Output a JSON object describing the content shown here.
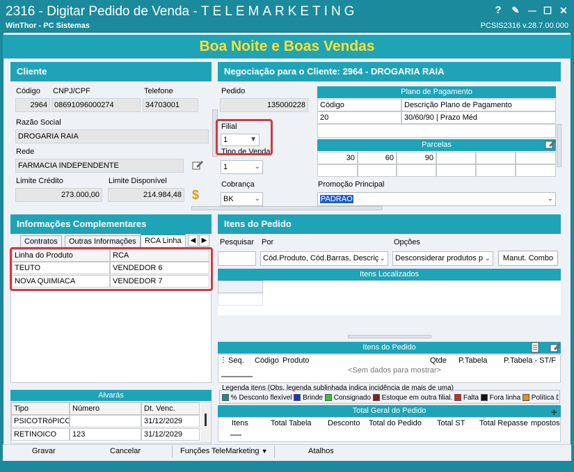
{
  "window": {
    "title_prefix": "2316 - Digitar Pedido de Venda - ",
    "title_suffix": "TELEMARKETING",
    "subtitle": "WinThor - PC Sistemas",
    "version": "PCSIS2316  v.28.7.00.000",
    "btn_help": "?",
    "btn_edit": "✎",
    "btn_min": "—",
    "btn_max": "☐",
    "btn_close": "✕"
  },
  "banner": "Boa Noite e Boas Vendas",
  "cliente": {
    "header": "Cliente",
    "codigo_label": "Código",
    "codigo": "2964",
    "cnpj_label": "CNPJ/CPF",
    "cnpj": "08691096000274",
    "telefone_label": "Telefone",
    "telefone": "34703001",
    "razao_label": "Razão Social",
    "razao": "DROGARIA RAIA",
    "rede_label": "Rede",
    "rede": "FARMACIA INDEPENDENTE",
    "limite_label": "Limite Crédito",
    "limite": "273.000,00",
    "disp_label": "Limite Disponível",
    "disp": "214.984,48",
    "dollar": "$"
  },
  "negociacao": {
    "header": "Negociação para o Cliente: 2964 - DROGARIA RAIA",
    "pedido_label": "Pedido",
    "pedido": "135000228",
    "filial_label": "Filial",
    "filial": "1",
    "tipo_label": "Tipo de Venda",
    "tipo": "1",
    "cobranca_label": "Cobrança",
    "cobranca": "BK",
    "plano_header": "Plano de Pagamento",
    "plano_col1": "Código",
    "plano_col2": "Descrição Plano de Pagamento",
    "plano_codigo": "20",
    "plano_desc": "30/60/90 | Prazo Méd",
    "parcelas_header": "Parcelas",
    "parcelas": [
      "30",
      "60",
      "90",
      "",
      "",
      "",
      ""
    ],
    "promo_label": "Promoção Principal",
    "promo": "PADRAO"
  },
  "info": {
    "header": "Informações Complementares",
    "tabs": [
      "Contratos",
      "Outras Informações",
      "RCA Linha"
    ],
    "col1": "Linha do Produto",
    "col2": "RCA",
    "rows": [
      {
        "linha": "TEUTO",
        "rca": "VENDEDOR 6"
      },
      {
        "linha": "NOVA QUIMIACA",
        "rca": "VENDEDOR 7"
      }
    ]
  },
  "alvaras": {
    "header": "Alvarás",
    "col1": "Tipo",
    "col2": "Número",
    "col3": "Dt. Venc.",
    "rows": [
      {
        "tipo": "PSICOTRóPICOS",
        "numero": "",
        "venc": "31/12/2029"
      },
      {
        "tipo": "RETINOICO",
        "numero": "123",
        "venc": "31/12/2029"
      }
    ]
  },
  "itens": {
    "header": "Itens do Pedido",
    "pesquisar_label": "Pesquisar",
    "por_label": "Por",
    "por_value": "Cód.Produto, Cód.Barras, Descriç",
    "opcoes_label": "Opções",
    "opcoes_value": "Desconsiderar produtos p",
    "manut_button": "Manut. Combo",
    "localizados_header": "Itens Localizados",
    "pedido_header": "Itens do Pedido",
    "cols": [
      "Seq.",
      "Código",
      "Produto",
      "Qtde",
      "P.Tabela",
      "P.Tabela - ST/F"
    ],
    "empty_text": "<Sem dados para mostrar>",
    "legend_title": "Legenda itens (Obs. legenda sublinhada indica incidência de mais de uma)",
    "legend": [
      {
        "label": "% Desconto flexível",
        "color": "#1f8a8a"
      },
      {
        "label": "Brinde",
        "color": "#1a2fd6"
      },
      {
        "label": "Consignado",
        "color": "#35c23a"
      },
      {
        "label": "Estoque em outra filial.",
        "color": "#8a1a1a"
      },
      {
        "label": "Falta",
        "color": "#e02424"
      },
      {
        "label": "Fora linha",
        "color": "#111111"
      },
      {
        "label": "Política Desc.",
        "color": "#f08a1a"
      }
    ],
    "total_header": "Total Geral do Pedido",
    "total_cols": [
      "Itens",
      "Total Tabela",
      "Desconto",
      "Total do Pedido",
      "Total ST",
      "Total Repasse",
      "mpostos"
    ]
  },
  "bottom": {
    "gravar": "Gravar",
    "cancelar": "Cancelar",
    "funcoes": "Funções TeleMarketing",
    "atalhos": "Atalhos"
  }
}
